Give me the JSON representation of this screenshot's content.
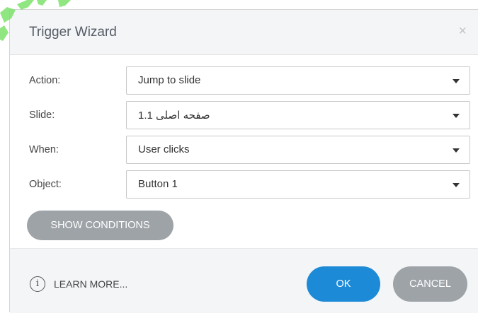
{
  "dialog": {
    "title": "Trigger Wizard",
    "close_symbol": "×"
  },
  "fields": [
    {
      "label": "Action:",
      "value": "Jump to slide"
    },
    {
      "label": "Slide:",
      "value": "1.1 صفحه اصلی"
    },
    {
      "label": "When:",
      "value": "User clicks"
    },
    {
      "label": "Object:",
      "value": "Button 1"
    }
  ],
  "show_conditions_label": "SHOW CONDITIONS",
  "footer": {
    "info_symbol": "i",
    "learn_more_label": "LEARN MORE...",
    "ok_label": "OK",
    "cancel_label": "CANCEL"
  },
  "colors": {
    "primary": "#1c8ad6",
    "secondary_button": "#9ea3a8",
    "watermark": "#7de26a"
  },
  "icons": [
    "close-icon",
    "dropdown-caret-icon",
    "info-icon"
  ]
}
